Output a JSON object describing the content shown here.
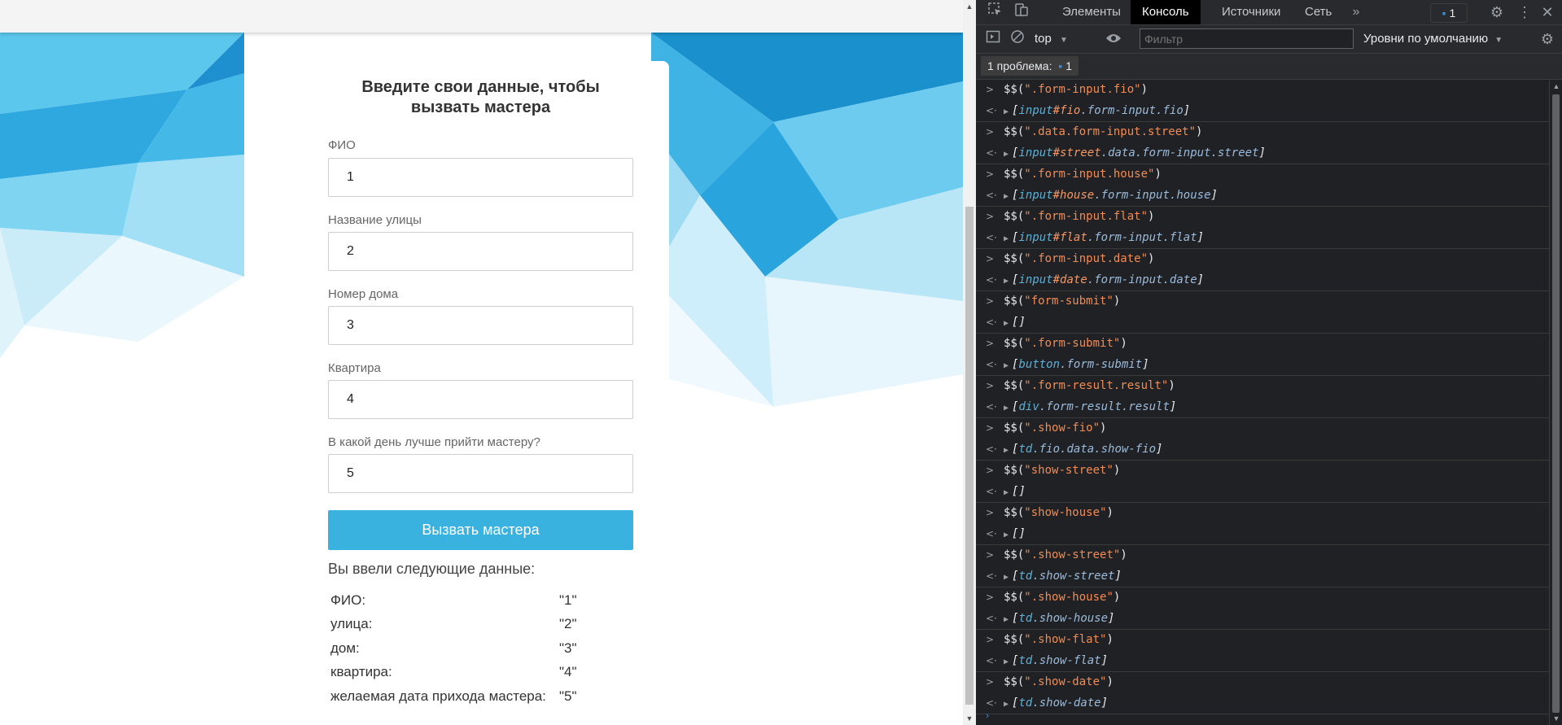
{
  "form": {
    "title_line1": "Введите свои данные, чтобы",
    "title_line2": "вызвать мастера",
    "fields": [
      {
        "label": "ФИО",
        "value": "1"
      },
      {
        "label": "Название улицы",
        "value": "2"
      },
      {
        "label": "Номер дома",
        "value": "3"
      },
      {
        "label": "Квартира",
        "value": "4"
      },
      {
        "label": "В какой день лучше прийти мастеру?",
        "value": "5"
      }
    ],
    "submit_label": "Вызвать мастера"
  },
  "result": {
    "heading": "Вы ввели следующие данные:",
    "rows": [
      {
        "key": "ФИО:",
        "value": "\"1\""
      },
      {
        "key": "улица:",
        "value": "\"2\""
      },
      {
        "key": "дом:",
        "value": "\"3\""
      },
      {
        "key": "квартира:",
        "value": "\"4\""
      },
      {
        "key": "желаемая дата прихода мастера:",
        "value": "\"5\""
      }
    ]
  },
  "devtools": {
    "tabs": [
      "Элементы",
      "Консоль",
      "Источники",
      "Сеть"
    ],
    "active_tab": "Консоль",
    "issues_count": "1",
    "context": "top",
    "filter_placeholder": "Фильтр",
    "levels": "Уровни по умолчанию",
    "problems_label": "1 проблема:",
    "problems_count": "1"
  },
  "console": [
    {
      "query": "\".form-input.fio\"",
      "tag": "input",
      "id": "#fio",
      "cls": ".form-input.fio"
    },
    {
      "query": "\".data.form-input.street\"",
      "tag": "input",
      "id": "#street",
      "cls": ".data.form-input.street"
    },
    {
      "query": "\".form-input.house\"",
      "tag": "input",
      "id": "#house",
      "cls": ".form-input.house"
    },
    {
      "query": "\".form-input.flat\"",
      "tag": "input",
      "id": "#flat",
      "cls": ".form-input.flat"
    },
    {
      "query": "\".form-input.date\"",
      "tag": "input",
      "id": "#date",
      "cls": ".form-input.date"
    },
    {
      "query": "\"form-submit\"",
      "tag": "",
      "id": "",
      "cls": ""
    },
    {
      "query": "\".form-submit\"",
      "tag": "button",
      "id": "",
      "cls": ".form-submit"
    },
    {
      "query": "\".form-result.result\"",
      "tag": "div",
      "id": "",
      "cls": ".form-result.result"
    },
    {
      "query": "\".show-fio\"",
      "tag": "td",
      "id": "",
      "cls": ".fio.data.show-fio"
    },
    {
      "query": "\"show-street\"",
      "tag": "",
      "id": "",
      "cls": ""
    },
    {
      "query": "\"show-house\"",
      "tag": "",
      "id": "",
      "cls": ""
    },
    {
      "query": "\".show-street\"",
      "tag": "td",
      "id": "",
      "cls": ".show-street"
    },
    {
      "query": "\".show-house\"",
      "tag": "td",
      "id": "",
      "cls": ".show-house"
    },
    {
      "query": "\".show-flat\"",
      "tag": "td",
      "id": "",
      "cls": ".show-flat"
    },
    {
      "query": "\".show-date\"",
      "tag": "td",
      "id": "",
      "cls": ".show-date"
    }
  ]
}
